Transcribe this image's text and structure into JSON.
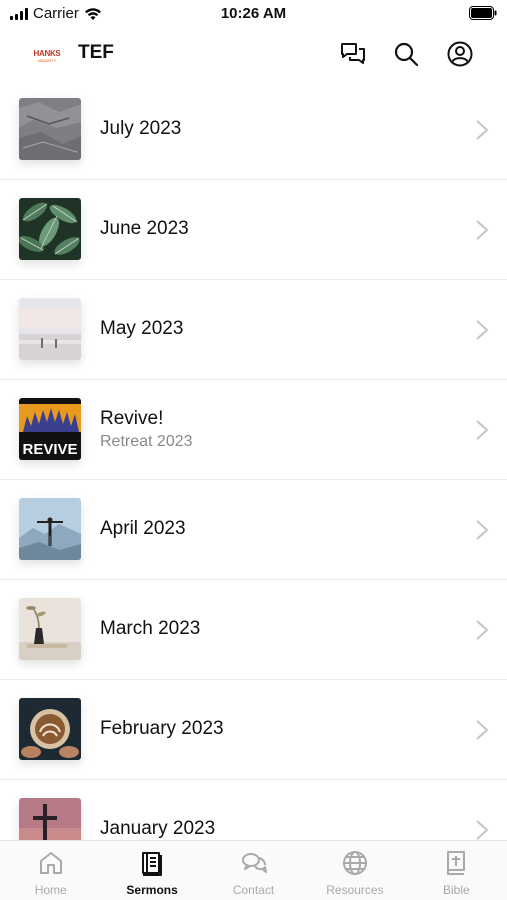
{
  "status_bar": {
    "carrier": "Carrier",
    "time": "10:26 AM"
  },
  "header": {
    "logo_text_top": "HANKS",
    "logo_text_bottom": "NGLISH T",
    "title": "TEF",
    "icons": [
      "chat-bubbles-icon",
      "search-icon",
      "account-icon"
    ]
  },
  "sermon_series": [
    {
      "title": "July 2023",
      "subtitle": "",
      "thumb": "rock-texture"
    },
    {
      "title": "June 2023",
      "subtitle": "",
      "thumb": "leaves"
    },
    {
      "title": "May 2023",
      "subtitle": "",
      "thumb": "beach-sky"
    },
    {
      "title": "Revive!",
      "subtitle": "Retreat 2023",
      "thumb": "revive-banner",
      "thumb_text": "REVIVE"
    },
    {
      "title": "April 2023",
      "subtitle": "",
      "thumb": "person-mountain"
    },
    {
      "title": "March 2023",
      "subtitle": "",
      "thumb": "vase-plant"
    },
    {
      "title": "February 2023",
      "subtitle": "",
      "thumb": "latte-cup"
    },
    {
      "title": "January 2023",
      "subtitle": "",
      "thumb": "cross-sunset"
    }
  ],
  "tab_bar": {
    "active": "Sermons",
    "tabs": [
      {
        "label": "Home",
        "icon": "home-icon"
      },
      {
        "label": "Sermons",
        "icon": "book-icon"
      },
      {
        "label": "Contact",
        "icon": "chat-icon"
      },
      {
        "label": "Resources",
        "icon": "globe-icon"
      },
      {
        "label": "Bible",
        "icon": "bible-icon"
      }
    ]
  },
  "colors": {
    "active_tab": "#111111",
    "inactive_tab": "#a9a9a9",
    "subtitle": "#8a8a8a",
    "divider": "#ececec"
  }
}
